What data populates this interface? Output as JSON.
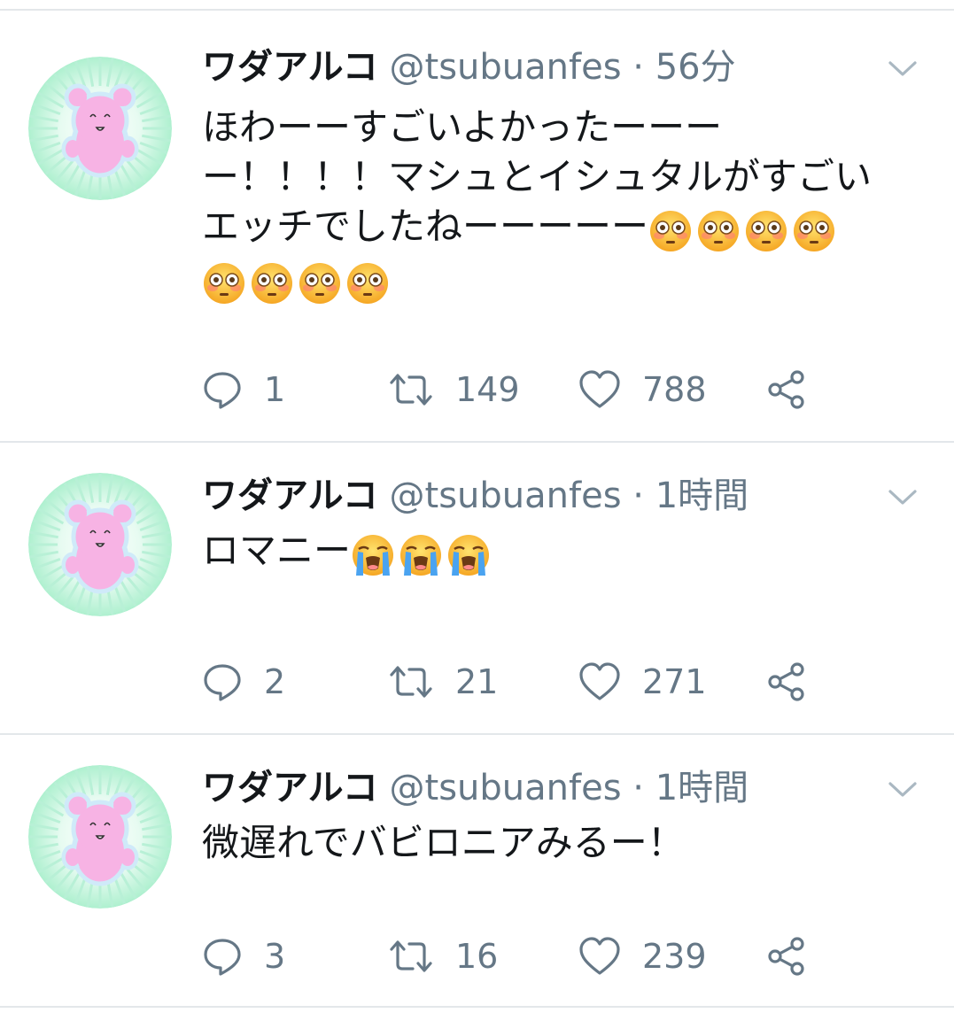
{
  "colors": {
    "name": "#14171a",
    "meta": "#657786",
    "divider": "#e3e7ea",
    "avatar_bg": "#aef0cf",
    "bear": "#f7b3e4"
  },
  "tweets": [
    {
      "name": "ワダアルコ",
      "handle": "@tsubuanfes",
      "time": "56分",
      "lines": [
        "ほわーーすごいよかったーーー",
        "ー！！！！マシュとイシュタルがすごい",
        "エッチでしたねーーーーー"
      ],
      "emoji_lines": [
        {
          "emoji": "flushed-face",
          "count": 4
        },
        {
          "emoji": "flushed-face",
          "count": 4
        }
      ],
      "replies": "1",
      "retweets": "149",
      "likes": "788"
    },
    {
      "name": "ワダアルコ",
      "handle": "@tsubuanfes",
      "time": "1時間",
      "lines": [
        "ロマニー"
      ],
      "emoji_lines": [
        {
          "emoji": "loudly-crying-face",
          "count": 3
        }
      ],
      "replies": "2",
      "retweets": "21",
      "likes": "271"
    },
    {
      "name": "ワダアルコ",
      "handle": "@tsubuanfes",
      "time": "1時間",
      "lines": [
        "微遅れでバビロニアみるー！"
      ],
      "emoji_lines": [],
      "replies": "3",
      "retweets": "16",
      "likes": "239"
    }
  ],
  "icons": {
    "reply": "reply-bubble-icon",
    "retweet": "retweet-icon",
    "like": "heart-icon",
    "share": "share-icon",
    "caret": "chevron-down-icon"
  },
  "separator": "·"
}
